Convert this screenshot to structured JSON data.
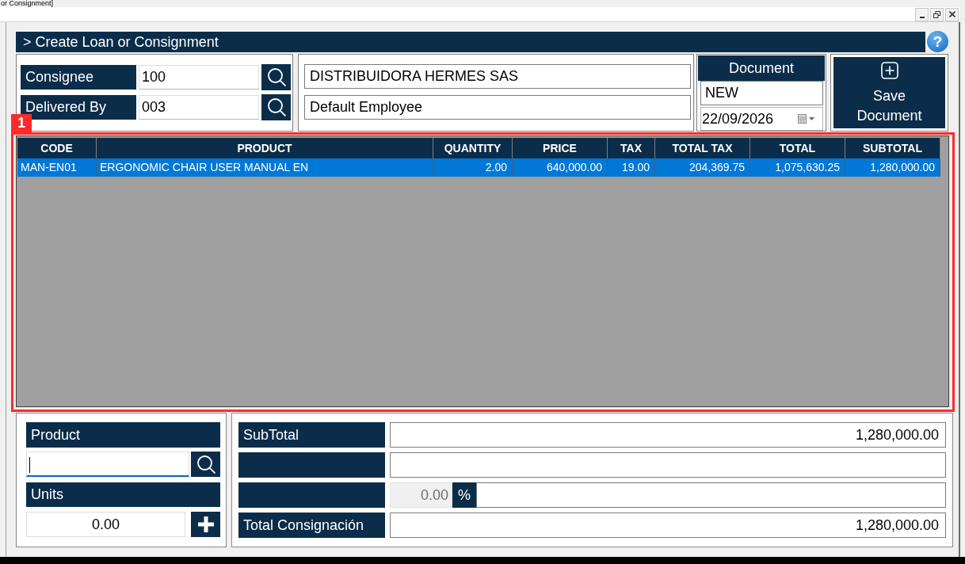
{
  "window": {
    "title": "or Consignment]"
  },
  "header": {
    "title": "> Create Loan or Consignment",
    "help": "?"
  },
  "parties": [
    {
      "label": "Consignee",
      "code": "100",
      "name": "DISTRIBUIDORA HERMES SAS"
    },
    {
      "label": "Delivered By",
      "code": "003",
      "name": "Default Employee"
    }
  ],
  "document": {
    "label": "Document",
    "number": "NEW",
    "date": "22/09/2026"
  },
  "save_button": {
    "label": "Save Document"
  },
  "annotation": {
    "label": "1"
  },
  "table": {
    "columns": [
      "CODE",
      "PRODUCT",
      "QUANTITY",
      "PRICE",
      "TAX",
      "TOTAL TAX",
      "TOTAL",
      "SUBTOTAL"
    ],
    "rows": [
      {
        "selected": true,
        "cells": [
          "MAN-EN01",
          "ERGONOMIC CHAIR USER MANUAL EN",
          "2.00",
          "640,000.00",
          "19.00",
          "204,369.75",
          "1,075,630.25",
          "1,280,000.00"
        ]
      }
    ]
  },
  "entry": {
    "product": {
      "label": "Product",
      "focused": true
    },
    "units": {
      "label": "Units",
      "value": "0.00",
      "focused": false
    }
  },
  "totals": [
    {
      "kind": "amount",
      "label": "SubTotal",
      "value": "1,280,000.00",
      "disabled": false
    },
    {
      "kind": "amount",
      "disabled": false
    },
    {
      "kind": "percent",
      "value": "0.00",
      "unit": "%",
      "disabled": true
    },
    {
      "kind": "amount",
      "label": "Total Consignación",
      "value": "1,280,000.00",
      "disabled": false
    }
  ]
}
